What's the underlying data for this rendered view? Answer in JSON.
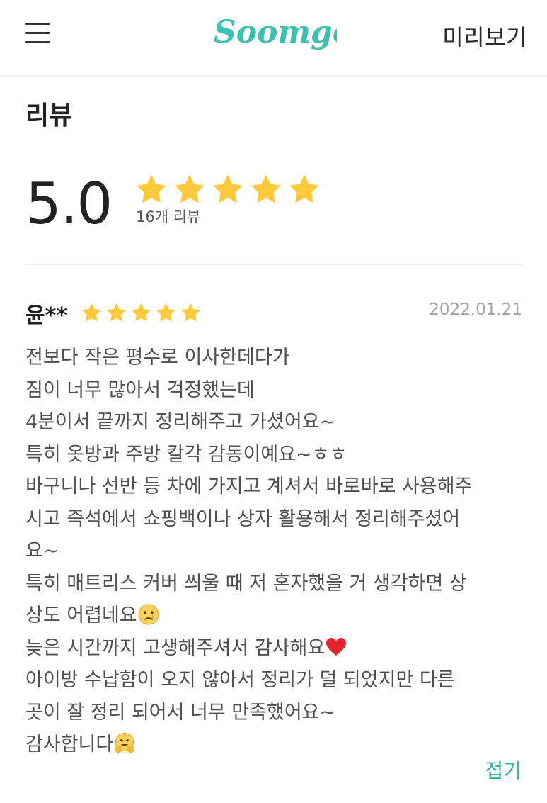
{
  "header": {
    "logo_text": "Soomgo",
    "preview_label": "미리보기",
    "brand_color": "#3bc1b0"
  },
  "reviews_section": {
    "title": "리뷰",
    "rating": {
      "score_text": "5.0",
      "stars": 5,
      "review_count_label": "16개 리뷰",
      "star_color": "#ffc93c"
    },
    "reviews": [
      {
        "name": "윤**",
        "stars": 5,
        "date": "2022.01.21",
        "lines": [
          "전보다 작은 평수로 이사한데다가",
          "짐이 너무 많아서 걱정했는데",
          "4분이서 끝까지 정리해주고 가셨어요~",
          "특히 옷방과 주방 칼각 감동이예요~ㅎㅎ",
          "바구니나 선반 등 차에 가지고 계셔서 바로바로 사용해주",
          "시고 즉석에서 쇼핑백이나 상자 활용해서 정리해주셨어",
          "요~",
          "특히 매트리스 커버 씌울 때 저 혼자했을 거 생각하면 상",
          "상도 어렵네요",
          "늦은 시간까지 고생해주셔서 감사해요",
          "아이방 수납함이 오지 않아서 정리가 덜 되었지만 다른",
          "곳이 잘 정리 되어서 너무 만족했어요~",
          "감사합니다"
        ],
        "emoji_icons": {
          "line_9": "crying-face-emoji-icon",
          "line_10": "red-heart-emoji-icon",
          "line_13": "hugging-face-emoji-icon"
        },
        "collapse_label": "접기"
      }
    ]
  }
}
